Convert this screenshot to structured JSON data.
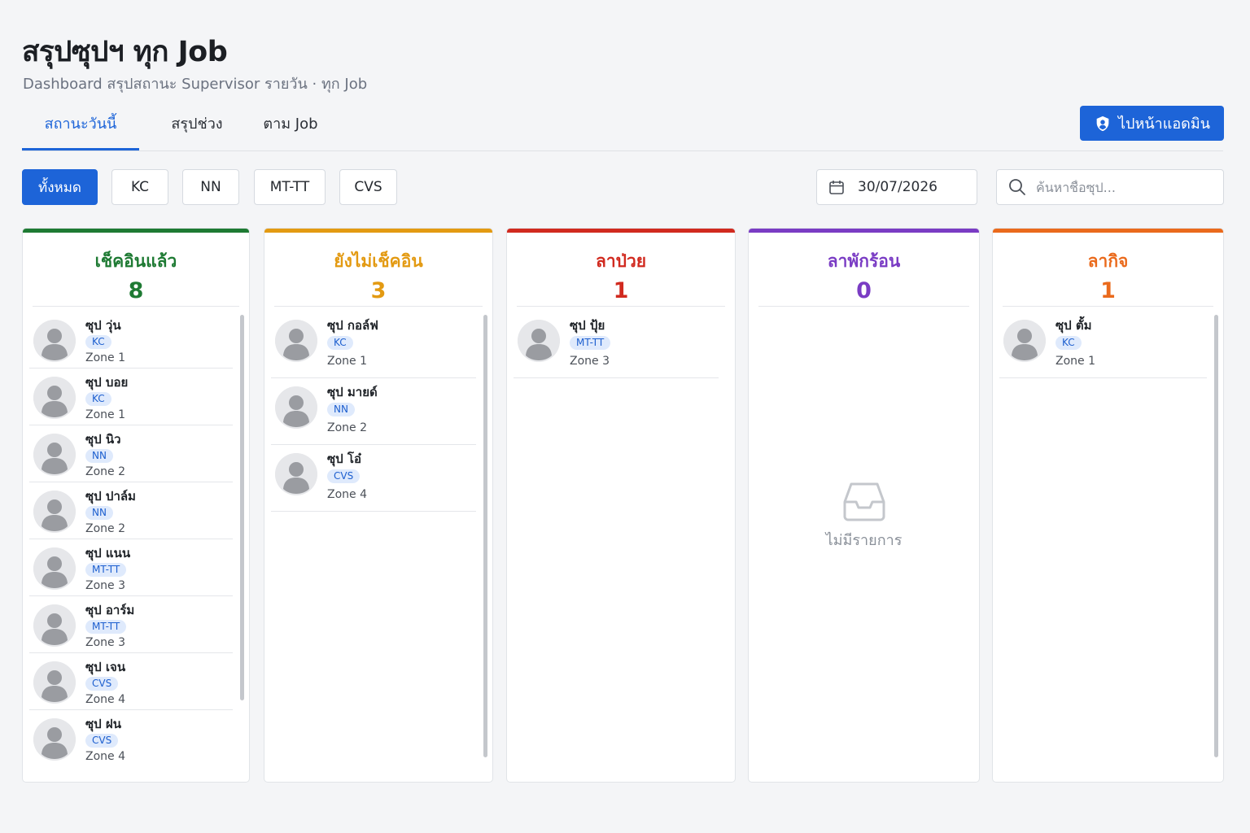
{
  "header": {
    "title": "สรุปซุปฯ ทุก Job",
    "subtitle": "Dashboard สรุปสถานะ Supervisor รายวัน · ทุก Job"
  },
  "tabs": [
    {
      "label": "สถานะวันนี้",
      "active": true
    },
    {
      "label": "สรุปช่วง",
      "active": false
    },
    {
      "label": "ตาม Job",
      "active": false
    }
  ],
  "admin_button": {
    "label": "ไปหน้าแอดมิน",
    "icon": "shield-user-icon"
  },
  "filters": [
    {
      "label": "ทั้งหมด",
      "active": true
    },
    {
      "label": "KC",
      "active": false
    },
    {
      "label": "NN",
      "active": false
    },
    {
      "label": "MT-TT",
      "active": false
    },
    {
      "label": "CVS",
      "active": false
    }
  ],
  "date": {
    "value": "30/07/2026",
    "icon": "calendar-icon"
  },
  "search": {
    "placeholder": "ค้นหาชื่อซุป...",
    "value": "",
    "icon": "search-icon"
  },
  "colors": {
    "primary": "#1d64d8",
    "checked_in": "#1e7a33",
    "not_checked_in": "#e39a12",
    "sick_leave": "#d12a1f",
    "vacation": "#7a3cc4",
    "personal_leave": "#ea6a1c"
  },
  "columns": [
    {
      "title": "เช็คอินแล้ว",
      "count": "8",
      "items": [
        {
          "name": "ซุป วุ่น",
          "job": "KC",
          "zone": "Zone 1"
        },
        {
          "name": "ซุป บอย",
          "job": "KC",
          "zone": "Zone 1"
        },
        {
          "name": "ซุป นิว",
          "job": "NN",
          "zone": "Zone 2"
        },
        {
          "name": "ซุป ปาล์ม",
          "job": "NN",
          "zone": "Zone 2"
        },
        {
          "name": "ซุป แนน",
          "job": "MT-TT",
          "zone": "Zone 3"
        },
        {
          "name": "ซุป อาร์ม",
          "job": "MT-TT",
          "zone": "Zone 3"
        },
        {
          "name": "ซุป เจน",
          "job": "CVS",
          "zone": "Zone 4"
        },
        {
          "name": "ซุป ฝน",
          "job": "CVS",
          "zone": "Zone 4"
        }
      ]
    },
    {
      "title": "ยังไม่เช็คอิน",
      "count": "3",
      "items": [
        {
          "name": "ซุป กอล์ฟ",
          "job": "KC",
          "zone": "Zone 1"
        },
        {
          "name": "ซุป มายด์",
          "job": "NN",
          "zone": "Zone 2"
        },
        {
          "name": "ซุป โอ๋",
          "job": "CVS",
          "zone": "Zone 4"
        }
      ]
    },
    {
      "title": "ลาป่วย",
      "count": "1",
      "items": [
        {
          "name": "ซุป ปุ้ย",
          "job": "MT-TT",
          "zone": "Zone 3"
        }
      ]
    },
    {
      "title": "ลาพักร้อน",
      "count": "0",
      "items": [],
      "empty_label": "ไม่มีรายการ"
    },
    {
      "title": "ลากิจ",
      "count": "1",
      "items": [
        {
          "name": "ซุป ตั้ม",
          "job": "KC",
          "zone": "Zone 1"
        }
      ]
    }
  ]
}
